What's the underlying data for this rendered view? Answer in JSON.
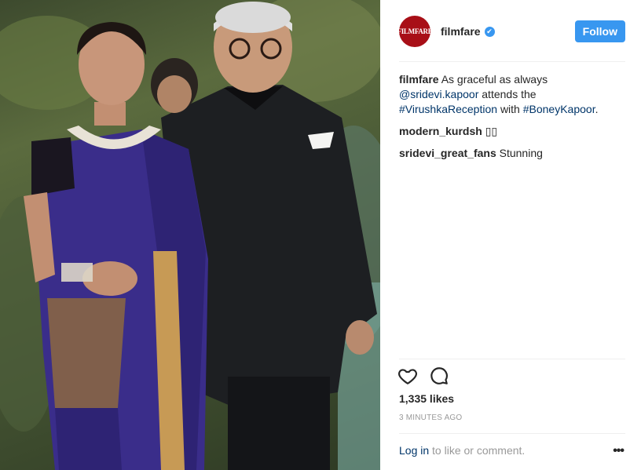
{
  "post": {
    "photo_alt": "Photo",
    "colors": {
      "accent": "#3897f0",
      "avatar": "#a80f17",
      "link": "#003569",
      "muted": "#999999"
    }
  },
  "header": {
    "avatar_text": "FILMFARE",
    "username": "filmfare",
    "verified_icon": "✔",
    "follow_label": "Follow"
  },
  "caption": {
    "username": "filmfare",
    "text_1": "As graceful as always",
    "mention": "@sridevi.kapoor",
    "text_2": "attends the",
    "hashtag_1": "#VirushkaReception",
    "text_3": "with",
    "hashtag_2": "#BoneyKapoor",
    "text_4": "."
  },
  "comments": [
    {
      "username": "modern_kurdsh",
      "text": "▯▯"
    },
    {
      "username": "sridevi_great_fans",
      "text": "Stunning"
    }
  ],
  "actions": {
    "like_icon": "heart-icon",
    "comment_icon": "comment-icon"
  },
  "likes": "1,335 likes",
  "timestamp": "3 MINUTES AGO",
  "footer": {
    "login_link": "Log in",
    "login_text": "to like or comment.",
    "more_label": "•••"
  }
}
